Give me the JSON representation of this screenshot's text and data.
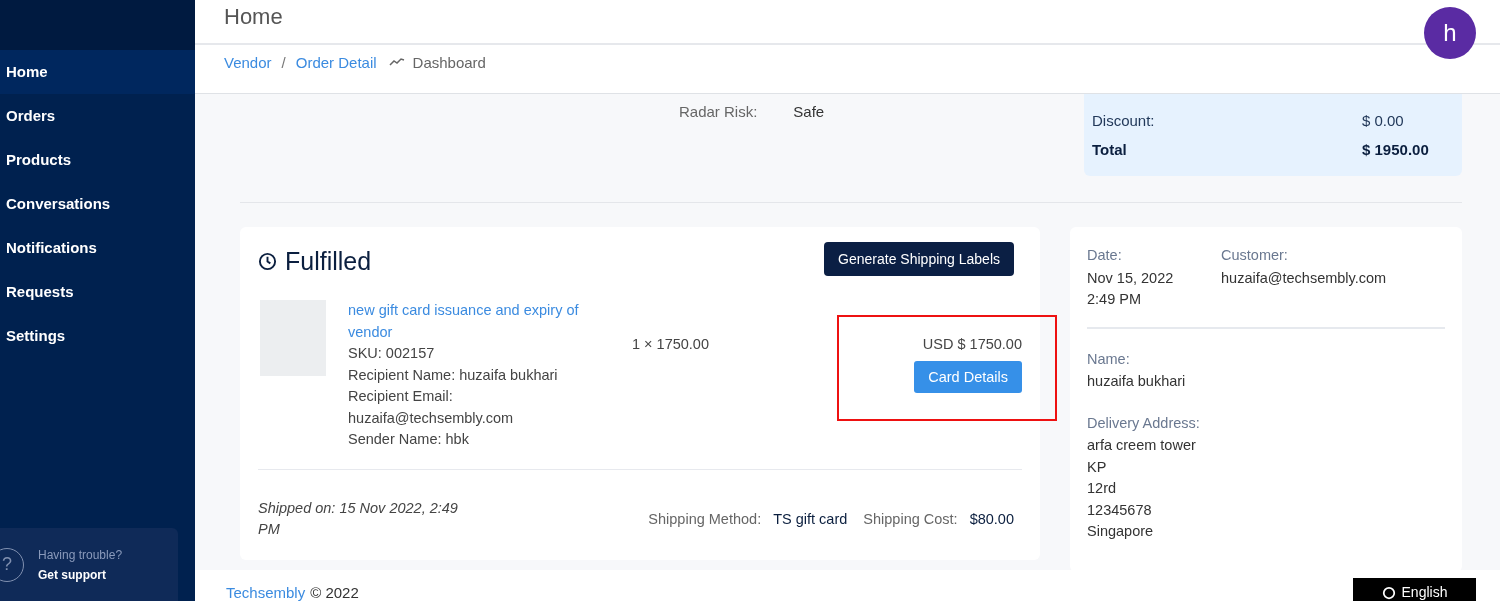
{
  "sidebar": {
    "items": [
      {
        "label": "Home",
        "selected": true
      },
      {
        "label": "Orders",
        "selected": false
      },
      {
        "label": "Products",
        "selected": false
      },
      {
        "label": "Conversations",
        "selected": false
      },
      {
        "label": "Notifications",
        "selected": false
      },
      {
        "label": "Requests",
        "selected": false
      },
      {
        "label": "Settings",
        "selected": false
      }
    ],
    "support": {
      "prompt": "Having trouble?",
      "link": "Get support",
      "icon": "?"
    }
  },
  "header": {
    "title": "Home",
    "avatar": "h"
  },
  "breadcrumb": {
    "links": [
      "Vendor",
      "Order Detail"
    ],
    "separator": "/",
    "current": "Dashboard"
  },
  "risk": {
    "label": "Radar Risk:",
    "value": "Safe"
  },
  "summary": [
    {
      "label": "Discount:",
      "value": "$ 0.00",
      "kind": "normal"
    },
    {
      "label": "Total",
      "value": "$ 1950.00",
      "kind": "total"
    }
  ],
  "fulfillment": {
    "title": "Fulfilled",
    "button": "Generate Shipping Labels",
    "item": {
      "name": "new gift card issuance and expiry of vendor",
      "details": [
        "SKU: 002157",
        "Recipient Name: huzaifa bukhari",
        "Recipient Email: huzaifa@techsembly.com",
        "Sender Name: hbk"
      ],
      "quantity": "1 × 1750.00",
      "price": "USD $ 1750.00",
      "action": "Card Details",
      "highlighted": true
    },
    "shipped": "Shipped on: 15 Nov 2022, 2:49 PM",
    "method_label": "Shipping Method:",
    "method": "TS gift card",
    "cost_label": "Shipping Cost:",
    "cost": "$80.00"
  },
  "customer": {
    "date_label": "Date:",
    "date": [
      "Nov 15, 2022",
      "2:49 PM"
    ],
    "customer_label": "Customer:",
    "customer": "huzaifa@techsembly.com",
    "name_label": "Name:",
    "name": "huzaifa bukhari",
    "address_label": "Delivery Address:",
    "address": [
      "arfa creem tower",
      "KP",
      "12rd",
      "12345678",
      "Singapore"
    ]
  },
  "footer": {
    "brand": "Techsembly",
    "copyright": "© 2022",
    "language": "English"
  }
}
